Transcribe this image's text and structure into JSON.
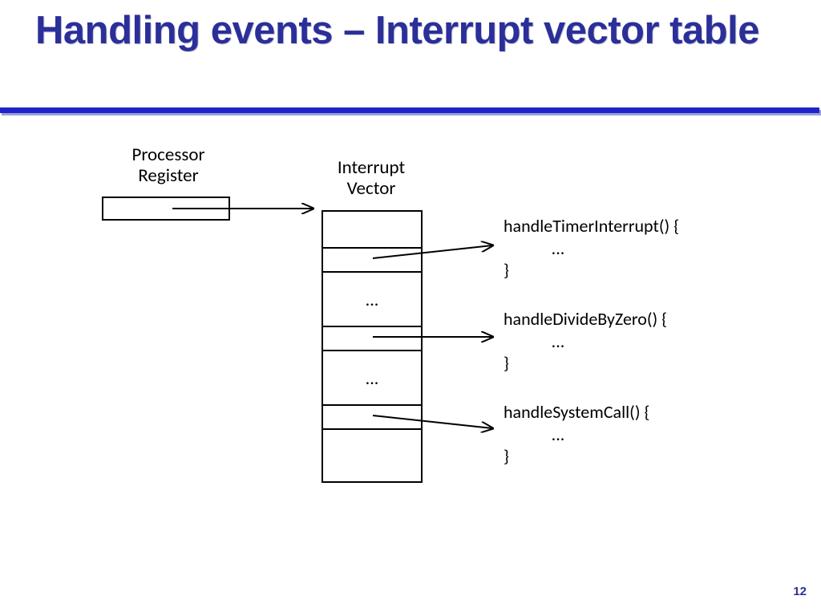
{
  "slide": {
    "title": "Handling events – Interrupt vector table",
    "page_number": "12"
  },
  "labels": {
    "processor_register": "Processor\nRegister",
    "interrupt_vector": "Interrupt\nVector"
  },
  "vector_cells": {
    "c3": "...",
    "c5": "..."
  },
  "handlers": {
    "timer": "handleTimerInterrupt() {\n            ...\n}",
    "divzero": "handleDivideByZero() {\n            ...\n}",
    "syscall": "handleSystemCall() {\n            ...\n}"
  }
}
